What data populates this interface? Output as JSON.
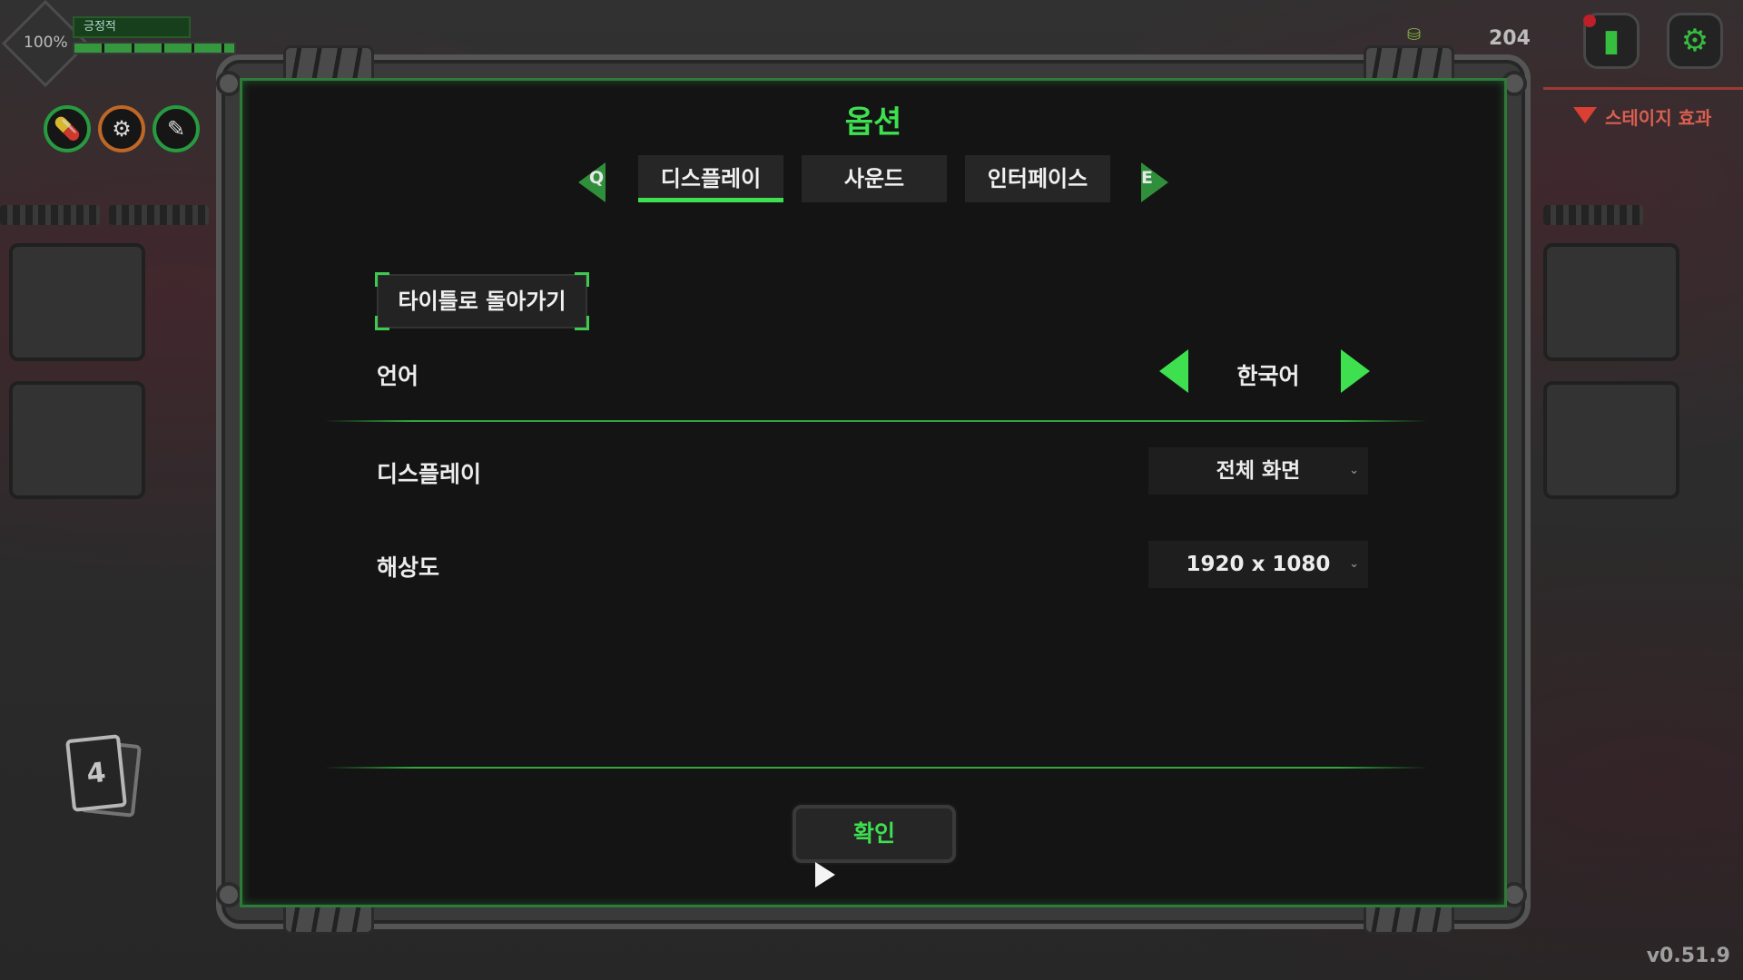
{
  "hud": {
    "hp_percent": "100%",
    "status_label": "긍정적",
    "hp_fraction": 1.0,
    "coins": "204",
    "stage_effect": "스테이지 효과",
    "deck_count": "4",
    "version": "v0.51.9",
    "skills": [
      {
        "icon": "pill-icon",
        "glyph": "💊"
      },
      {
        "icon": "gear-skill-icon",
        "glyph": "⚙"
      },
      {
        "icon": "syringe-icon",
        "glyph": "✎"
      }
    ]
  },
  "dialog": {
    "title": "옵션",
    "tabs": [
      {
        "label": "디스플레이",
        "active": true
      },
      {
        "label": "사운드",
        "active": false
      },
      {
        "label": "인터페이스",
        "active": false
      }
    ],
    "prev_tab_key": "Q",
    "next_tab_key": "E",
    "back_to_title": "타이틀로 돌아가기",
    "language": {
      "label": "언어",
      "value": "한국어"
    },
    "display": {
      "label": "디스플레이",
      "value": "전체 화면"
    },
    "resolution": {
      "label": "해상도",
      "value": "1920 x 1080"
    },
    "confirm": "확인"
  },
  "colors": {
    "accent": "#3ee04f",
    "panel": "#141414",
    "stage_effect": "#ff7060"
  }
}
